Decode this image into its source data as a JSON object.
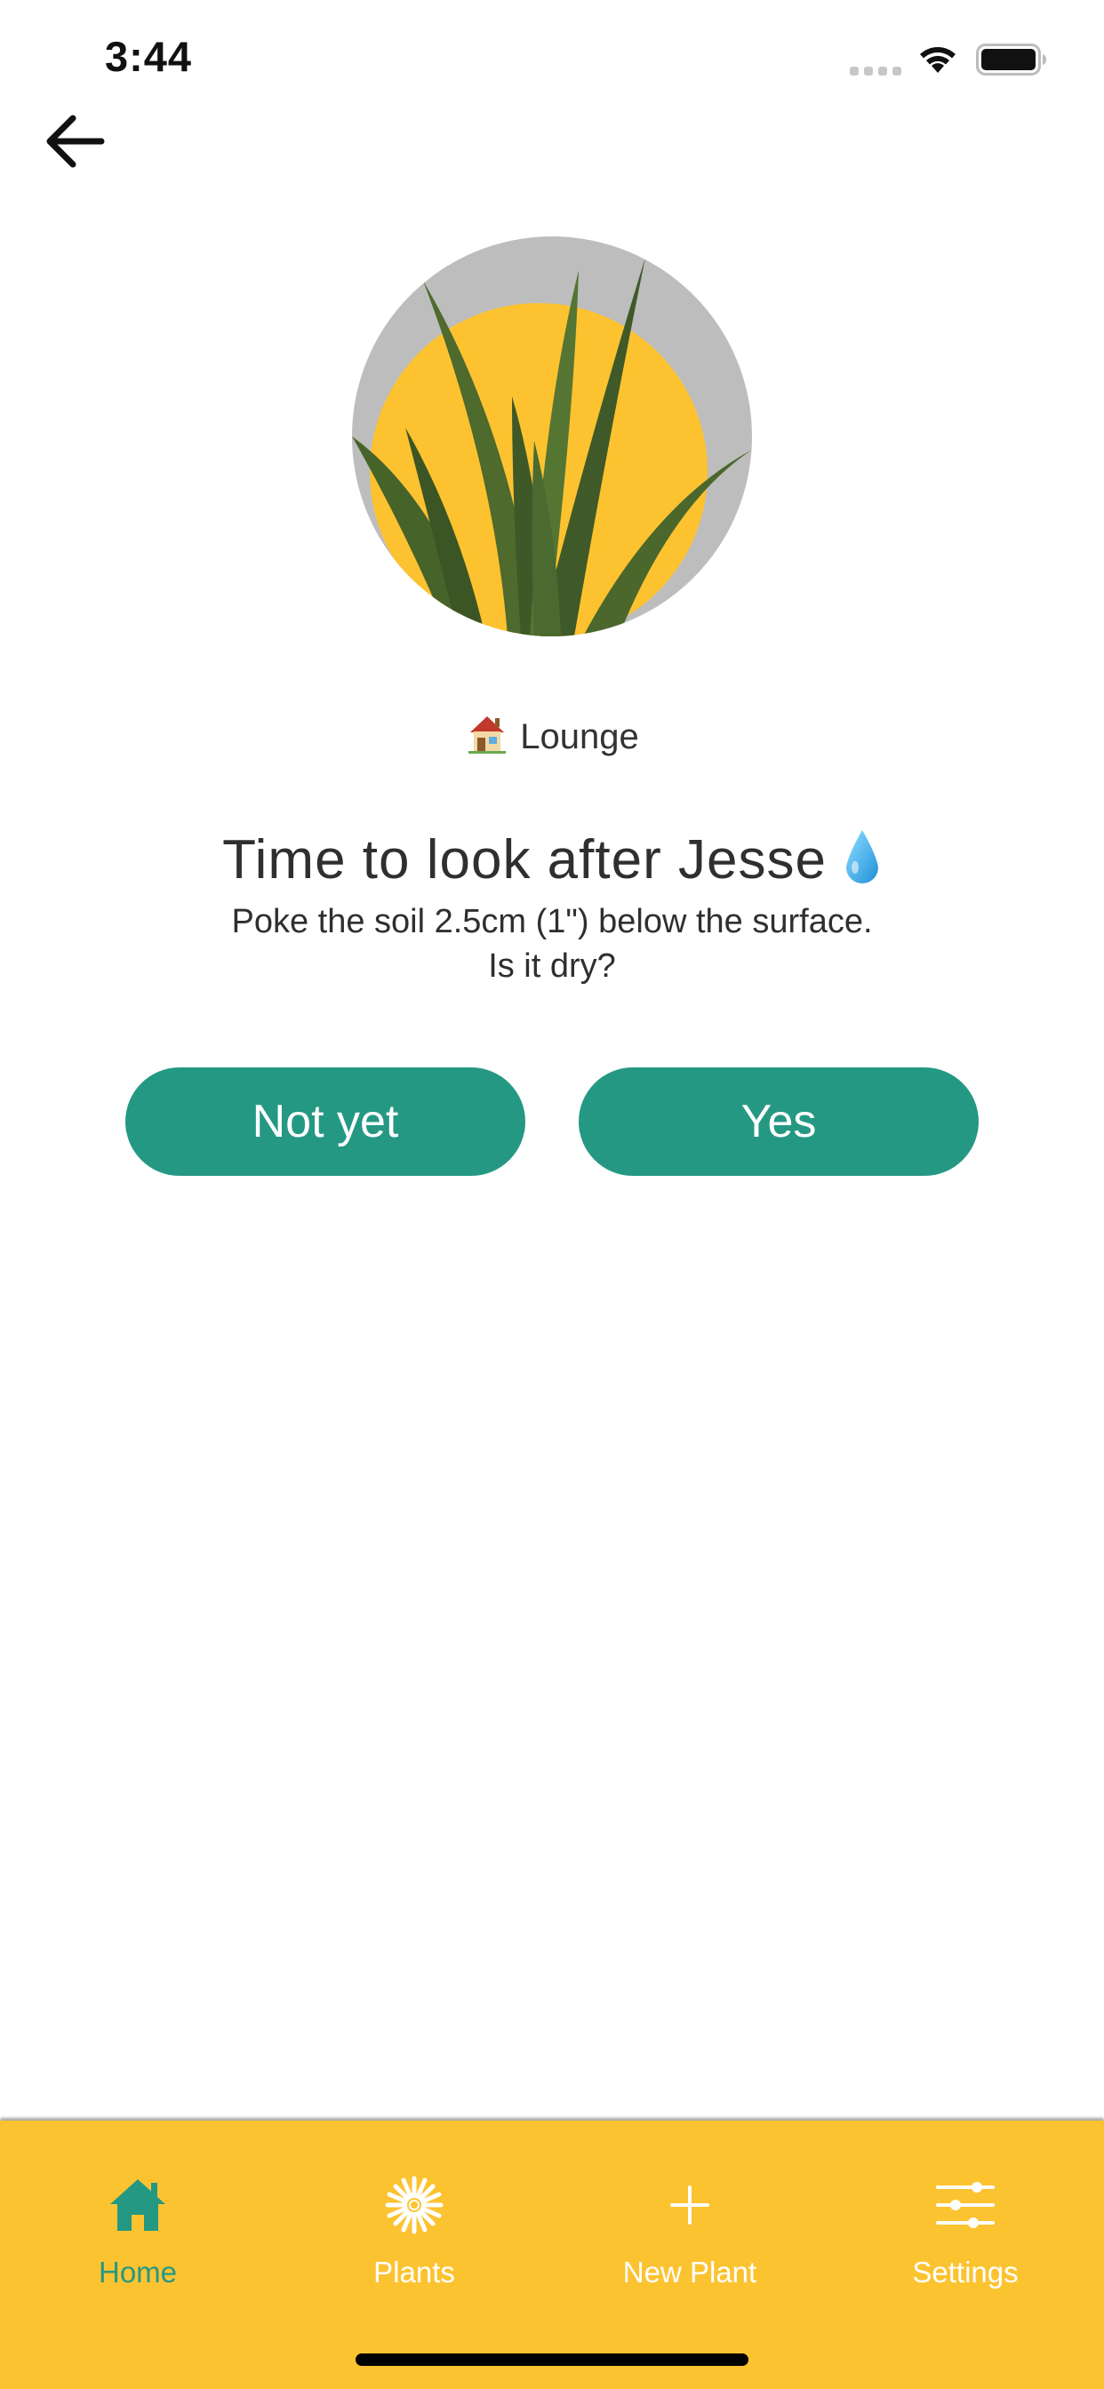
{
  "status_bar": {
    "time": "3:44"
  },
  "navigation": {
    "back_icon": "arrow-left-icon"
  },
  "plant": {
    "location": "Lounge",
    "location_icon": "house-emoji-icon",
    "title": "Time to look after Jesse",
    "title_icon": "water-drop-icon",
    "instruction_line1": "Poke the soil 2.5cm (1\") below the surface.",
    "instruction_line2": "Is it dry?"
  },
  "actions": {
    "not_yet_label": "Not yet",
    "yes_label": "Yes"
  },
  "tab_bar": {
    "items": [
      {
        "label": "Home",
        "icon": "home-icon",
        "active": true
      },
      {
        "label": "Plants",
        "icon": "flower-icon",
        "active": false
      },
      {
        "label": "New Plant",
        "icon": "plus-icon",
        "active": false
      },
      {
        "label": "Settings",
        "icon": "sliders-icon",
        "active": false
      }
    ]
  },
  "colors": {
    "accent_teal": "#259883",
    "tab_bar_yellow": "#fcc331",
    "tab_inactive": "#ffffff"
  }
}
